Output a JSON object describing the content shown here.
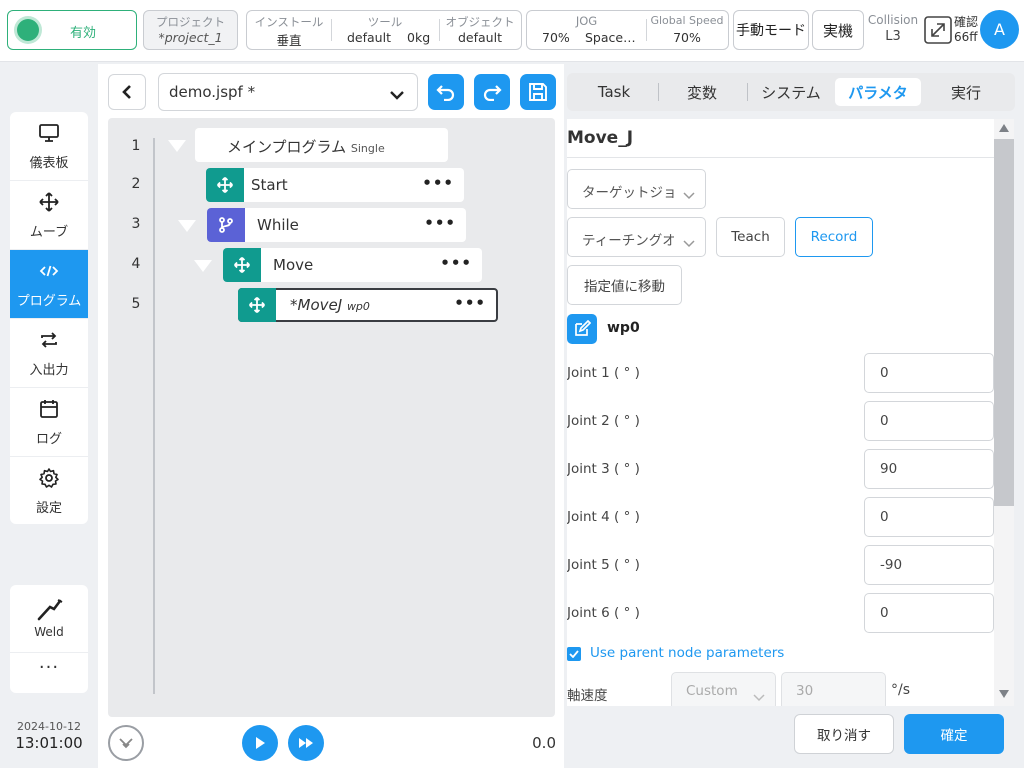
{
  "topbar": {
    "enable_label": "有効",
    "project_label": "プロジェクト",
    "project_value": "*project_1",
    "install_label": "インストール",
    "install_value": "垂直",
    "tool_label": "ツール",
    "tool_value": "default",
    "tool_weight": "0kg",
    "object_label": "オブジェクト",
    "object_value": "default",
    "jog_label": "JOG",
    "jog_value": "70%",
    "jog_space": "Space…",
    "global_speed_label": "Global Speed",
    "global_speed_value": "70%",
    "manual_mode": "手動モード",
    "real_machine": "実機",
    "collision_label": "Collision",
    "collision_value": "L3",
    "confirm_label": "確認",
    "confirm_value": "66ff",
    "avatar": "A",
    "accent_color": "#1e98f0",
    "enable_color": "#2eb07a"
  },
  "nav": {
    "items": [
      {
        "label": "儀表板",
        "icon": "monitor-icon"
      },
      {
        "label": "ムーブ",
        "icon": "move-arrows-icon"
      },
      {
        "label": "プログラム",
        "icon": "code-icon"
      },
      {
        "label": "入出力",
        "icon": "swap-icon"
      },
      {
        "label": "ログ",
        "icon": "calendar-icon"
      },
      {
        "label": "設定",
        "icon": "gear-icon"
      }
    ],
    "weld_label": "Weld",
    "more_label": "···",
    "date": "2024-10-12",
    "time": "13:01:00"
  },
  "editor": {
    "file_name": "demo.jspf *",
    "lines": [
      "1",
      "2",
      "3",
      "4",
      "5"
    ],
    "root_label": "メインプログラム",
    "root_tag": "Single",
    "nodes": [
      {
        "label": "Start",
        "tag": ""
      },
      {
        "label": "While",
        "tag": ""
      },
      {
        "label": "Move",
        "tag": ""
      },
      {
        "label": "*MoveJ",
        "tag": "wp0"
      }
    ],
    "node_menu": "•••",
    "speed_readout": "0.0"
  },
  "tabs": [
    "Task",
    "変数",
    "システム",
    "パラメタ",
    "実行"
  ],
  "params": {
    "title": "Move_J",
    "target_select": "ターゲットジョ",
    "teaching_select": "ティーチングオ",
    "teach_button": "Teach",
    "record_button": "Record",
    "move_to_button": "指定値に移動",
    "waypoint": "wp0",
    "joints": [
      {
        "label": "Joint 1 ( ° )",
        "value": "0"
      },
      {
        "label": "Joint 2 ( ° )",
        "value": "0"
      },
      {
        "label": "Joint 3 ( ° )",
        "value": "90"
      },
      {
        "label": "Joint 4 ( ° )",
        "value": "0"
      },
      {
        "label": "Joint 5 ( ° )",
        "value": "-90"
      },
      {
        "label": "Joint 6 ( ° )",
        "value": "0"
      }
    ],
    "use_parent_label": "Use parent node parameters",
    "axis_speed_label": "軸速度",
    "axis_speed_mode": "Custom",
    "axis_speed_value": "30",
    "axis_speed_unit": "°/s"
  },
  "footer": {
    "cancel": "取り消す",
    "ok": "確定"
  }
}
